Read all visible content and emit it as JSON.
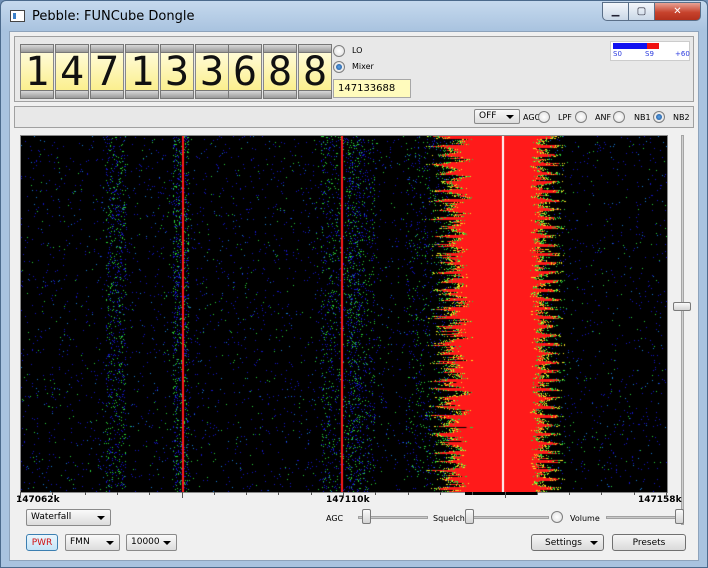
{
  "window": {
    "title": "Pebble: FUNCube Dongle",
    "app_icon": "window-app-icon",
    "minimize_glyph": "▁",
    "maximize_glyph": "▢",
    "close_glyph": "✕"
  },
  "frequency": {
    "groups": [
      [
        "1",
        "4",
        "7"
      ],
      [
        "1",
        "3",
        "3"
      ],
      [
        "6",
        "8",
        "8"
      ]
    ],
    "entry_value": "147133688"
  },
  "mode_radios": {
    "lo_label": "LO",
    "mixer_label": "Mixer",
    "selected": "Mixer"
  },
  "smeter": {
    "s0": "S0",
    "s9": "S9",
    "plus60": "+60",
    "level_fraction": 0.6
  },
  "toolbar": {
    "agc_select": "OFF",
    "agc_label": "AGC",
    "lpf_label": "LPF",
    "anf_label": "ANF",
    "nb1_label": "NB1",
    "nb2_label": "NB2",
    "nb1_selected": true
  },
  "spectrum": {
    "x_labels": [
      "147062k",
      "147110k",
      "147158k"
    ],
    "colors": {
      "background": "#000000",
      "signal": "#ff1a1a",
      "noise_low": "#1515c8",
      "noise_high": "#2ad23a",
      "marker": "#ffffff"
    }
  },
  "display_select": "Waterfall",
  "audio": {
    "agc_label": "AGC",
    "squelch_label": "Squelch",
    "volume_label": "Volume"
  },
  "bottom": {
    "pwr_label": "PWR",
    "mode_select": "FMN",
    "step_select": "10000",
    "settings_label": "Settings",
    "presets_label": "Presets"
  }
}
